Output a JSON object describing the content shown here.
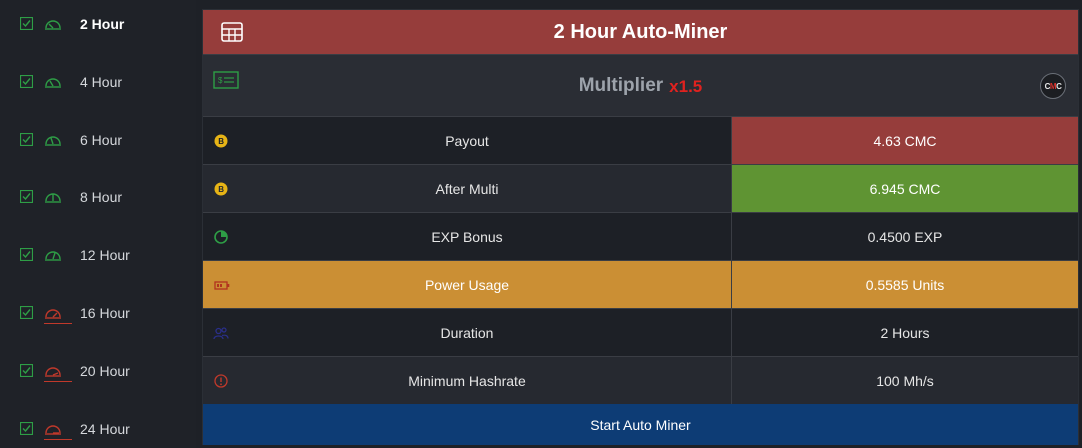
{
  "sidebar": {
    "items": [
      {
        "label": "2 Hour",
        "active": true,
        "level": "low"
      },
      {
        "label": "4 Hour",
        "active": false,
        "level": "low"
      },
      {
        "label": "6 Hour",
        "active": false,
        "level": "low"
      },
      {
        "label": "8 Hour",
        "active": false,
        "level": "low"
      },
      {
        "label": "12 Hour",
        "active": false,
        "level": "low"
      },
      {
        "label": "16 Hour",
        "active": false,
        "level": "high"
      },
      {
        "label": "20 Hour",
        "active": false,
        "level": "high"
      },
      {
        "label": "24 Hour",
        "active": false,
        "level": "high"
      }
    ]
  },
  "panel": {
    "title": "2 Hour Auto-Miner",
    "multiplier_label": "Multiplier",
    "multiplier_value": "x1.5",
    "badge": {
      "left": "C",
      "mid": "M",
      "right": "C"
    },
    "rows": [
      {
        "label": "Payout",
        "value": "4.63 CMC",
        "icon": "bitcoin-coin-icon"
      },
      {
        "label": "After Multi",
        "value": "6.945 CMC",
        "icon": "bitcoin-coin-icon"
      },
      {
        "label": "EXP Bonus",
        "value": "0.4500 EXP",
        "icon": "pie-chart-icon"
      },
      {
        "label": "Power Usage",
        "value": "0.5585 Units",
        "icon": "battery-icon"
      },
      {
        "label": "Duration",
        "value": "2 Hours",
        "icon": "users-icon"
      },
      {
        "label": "Minimum Hashrate",
        "value": "100 Mh/s",
        "icon": "alert-circle-icon"
      }
    ],
    "start_label": "Start Auto Miner"
  },
  "colors": {
    "header_red": "#963d3b",
    "green": "#5f9433",
    "amber": "#cb8f34",
    "button_blue": "#0d3c75",
    "check_green": "#2e9e46",
    "gauge_red": "#c0392b"
  }
}
